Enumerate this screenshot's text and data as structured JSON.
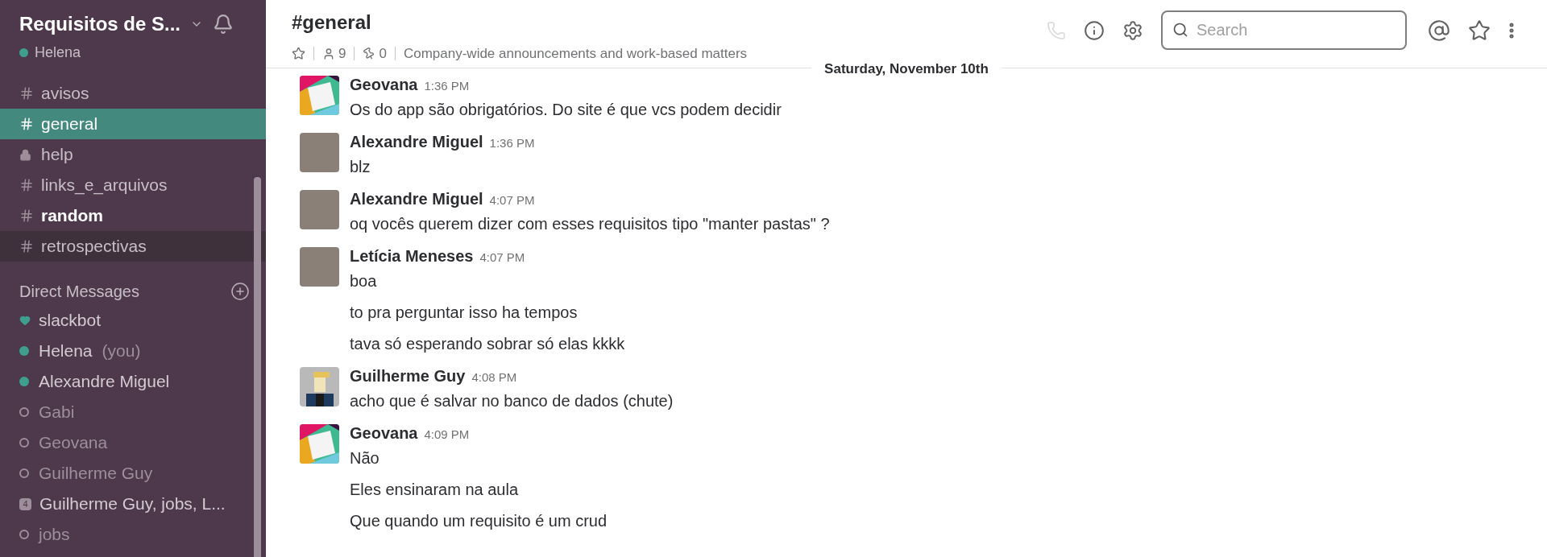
{
  "sidebar": {
    "team_name": "Requisitos de S...",
    "user": {
      "name": "Helena",
      "online": true
    },
    "channels": [
      {
        "kind": "public",
        "name": "avisos",
        "selected": false,
        "unread": false,
        "hovered": false
      },
      {
        "kind": "public",
        "name": "general",
        "selected": true,
        "unread": false,
        "hovered": false
      },
      {
        "kind": "private",
        "name": "help",
        "selected": false,
        "unread": false,
        "hovered": false
      },
      {
        "kind": "public",
        "name": "links_e_arquivos",
        "selected": false,
        "unread": false,
        "hovered": false
      },
      {
        "kind": "public",
        "name": "random",
        "selected": false,
        "unread": true,
        "hovered": false
      },
      {
        "kind": "public",
        "name": "retrospectivas",
        "selected": false,
        "unread": false,
        "hovered": true
      }
    ],
    "dm_heading": "Direct Messages",
    "direct_messages": [
      {
        "kind": "bot",
        "name": "slackbot"
      },
      {
        "kind": "person",
        "name": "Helena",
        "suffix": "(you)",
        "online": true
      },
      {
        "kind": "person",
        "name": "Alexandre Miguel",
        "online": true
      },
      {
        "kind": "person",
        "name": "Gabi",
        "online": false
      },
      {
        "kind": "person",
        "name": "Geovana",
        "online": false
      },
      {
        "kind": "person",
        "name": "Guilherme Guy",
        "online": false
      },
      {
        "kind": "group",
        "name": "Guilherme Guy, jobs, L...",
        "count": "4"
      },
      {
        "kind": "person",
        "name": "jobs",
        "online": false
      }
    ]
  },
  "header": {
    "title": "#general",
    "members": "9",
    "pins": "0",
    "topic": "Company-wide announcements and work-based matters",
    "search": {
      "placeholder": "Search"
    }
  },
  "date_divider": "Saturday, November 10th",
  "messages": [
    {
      "kind": "logo",
      "author": "Geovana",
      "time": "1:36 PM",
      "lines": [
        "Os do app são obrigatórios. Do site é que vcs podem decidir"
      ]
    },
    {
      "kind": "photo",
      "author": "Alexandre Miguel",
      "time": "1:36 PM",
      "lines": [
        "blz"
      ]
    },
    {
      "kind": "photo",
      "author": "Alexandre Miguel",
      "time": "4:07 PM",
      "lines": [
        "oq vocês querem dizer com esses requisitos tipo \"manter pastas\" ?"
      ]
    },
    {
      "kind": "photo",
      "author": "Letícia Meneses",
      "time": "4:07 PM",
      "lines": [
        "boa",
        "to pra perguntar isso ha tempos",
        "tava só esperando sobrar só elas kkkk"
      ]
    },
    {
      "kind": "pixel",
      "author": "Guilherme Guy",
      "time": "4:08 PM",
      "lines": [
        "acho que é salvar no banco de dados (chute)"
      ]
    },
    {
      "kind": "logo",
      "author": "Geovana",
      "time": "4:09 PM",
      "lines": [
        "Não",
        "Eles ensinaram na aula",
        "Que quando um requisito é um crud"
      ]
    }
  ]
}
